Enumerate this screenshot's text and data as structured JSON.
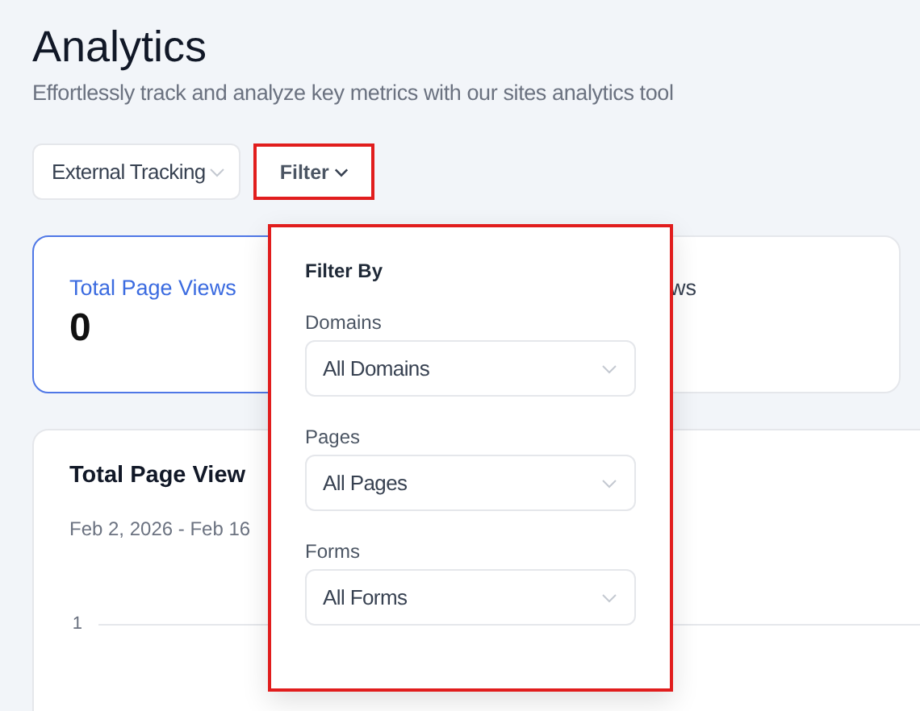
{
  "header": {
    "title": "Analytics",
    "subtitle": "Effortlessly track and analyze key metrics with our sites analytics tool"
  },
  "toolbar": {
    "source_select": "External Tracking",
    "filter_button": "Filter",
    "filter_expanded": true
  },
  "stat_cards": [
    {
      "label": "Total Page Views",
      "value": "0",
      "selected": true
    },
    {
      "label": "ws",
      "selected": false
    }
  ],
  "chart_card": {
    "title": "Total Page View",
    "date_range": "Feb 2, 2026 - Feb 16",
    "y_tick": "1"
  },
  "filter_menu": {
    "heading": "Filter By",
    "fields": [
      {
        "label": "Domains",
        "value": "All Domains"
      },
      {
        "label": "Pages",
        "value": "All Pages"
      },
      {
        "label": "Forms",
        "value": "All Forms"
      }
    ]
  }
}
